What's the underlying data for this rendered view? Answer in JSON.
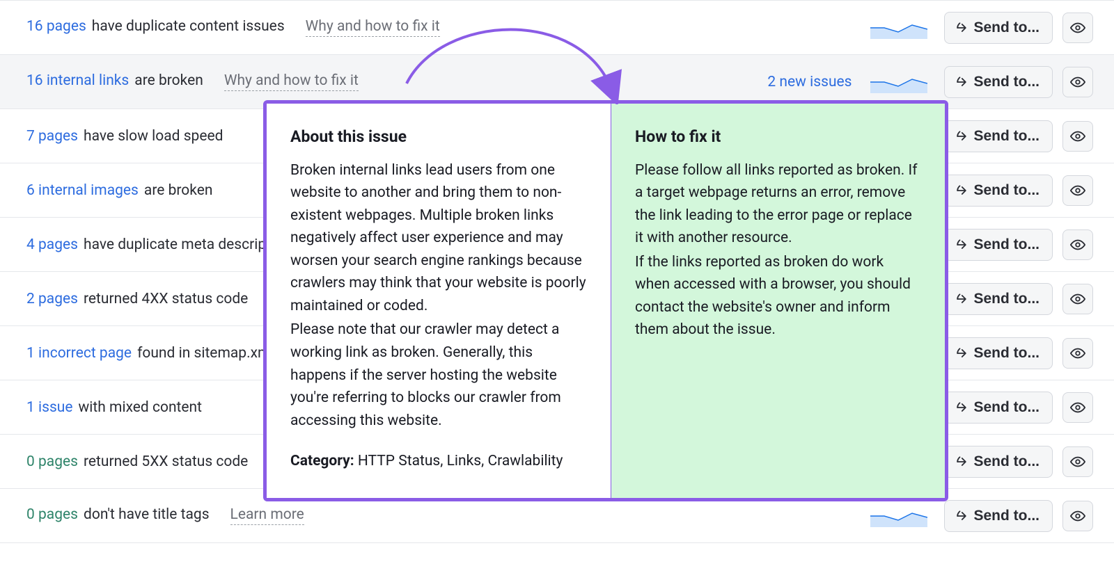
{
  "common": {
    "why_link": "Why and how to fix it",
    "learn_more": "Learn more",
    "send_button": "Send to..."
  },
  "rows": [
    {
      "count_text": "16 pages",
      "desc": "have duplicate content issues",
      "why": true,
      "new_issues": "",
      "disabled": false,
      "highlight": false
    },
    {
      "count_text": "16 internal links",
      "desc": "are broken",
      "why": true,
      "new_issues": "2 new issues",
      "disabled": false,
      "highlight": true
    },
    {
      "count_text": "7 pages",
      "desc": "have slow load speed",
      "why": false,
      "new_issues": "",
      "disabled": false,
      "highlight": false
    },
    {
      "count_text": "6 internal images",
      "desc": "are broken",
      "why": false,
      "new_issues": "",
      "disabled": false,
      "highlight": false
    },
    {
      "count_text": "4 pages",
      "desc": "have duplicate meta descriptions",
      "why": false,
      "new_issues": "",
      "disabled": false,
      "highlight": false
    },
    {
      "count_text": "2 pages",
      "desc": "returned 4XX status code",
      "why": false,
      "new_issues": "",
      "disabled": false,
      "highlight": false
    },
    {
      "count_text": "1 incorrect page",
      "desc": "found in sitemap.xml",
      "why": false,
      "new_issues": "",
      "disabled": false,
      "highlight": false
    },
    {
      "count_text": "1 issue",
      "desc": "with mixed content",
      "why": false,
      "new_issues": "",
      "disabled": false,
      "highlight": false
    },
    {
      "count_text": "0 pages",
      "desc": "returned 5XX status code",
      "why": false,
      "new_issues": "",
      "disabled": true,
      "highlight": false
    },
    {
      "count_text": "0 pages",
      "desc": "don't have title tags",
      "why": false,
      "learn": true,
      "new_issues": "",
      "disabled": true,
      "highlight": false
    }
  ],
  "popover": {
    "about_title": "About this issue",
    "about_body_1": "Broken internal links lead users from one website to another and bring them to non-existent webpages. Multiple broken links negatively affect user experience and may worsen your search engine rankings because crawlers may think that your website is poorly maintained or coded.",
    "about_body_2": "Please note that our crawler may detect a working link as broken. Generally, this happens if the server hosting the website you're referring to blocks our crawler from accessing this website.",
    "category_label": "Category:",
    "category_value": "HTTP Status, Links, Crawlability",
    "fix_title": "How to fix it",
    "fix_body_1": "Please follow all links reported as broken. If a target webpage returns an error, remove the link leading to the error page or replace it with another resource.",
    "fix_body_2": "If the links reported as broken do work when accessed with a browser, you should contact the website's owner and inform them about the issue."
  }
}
